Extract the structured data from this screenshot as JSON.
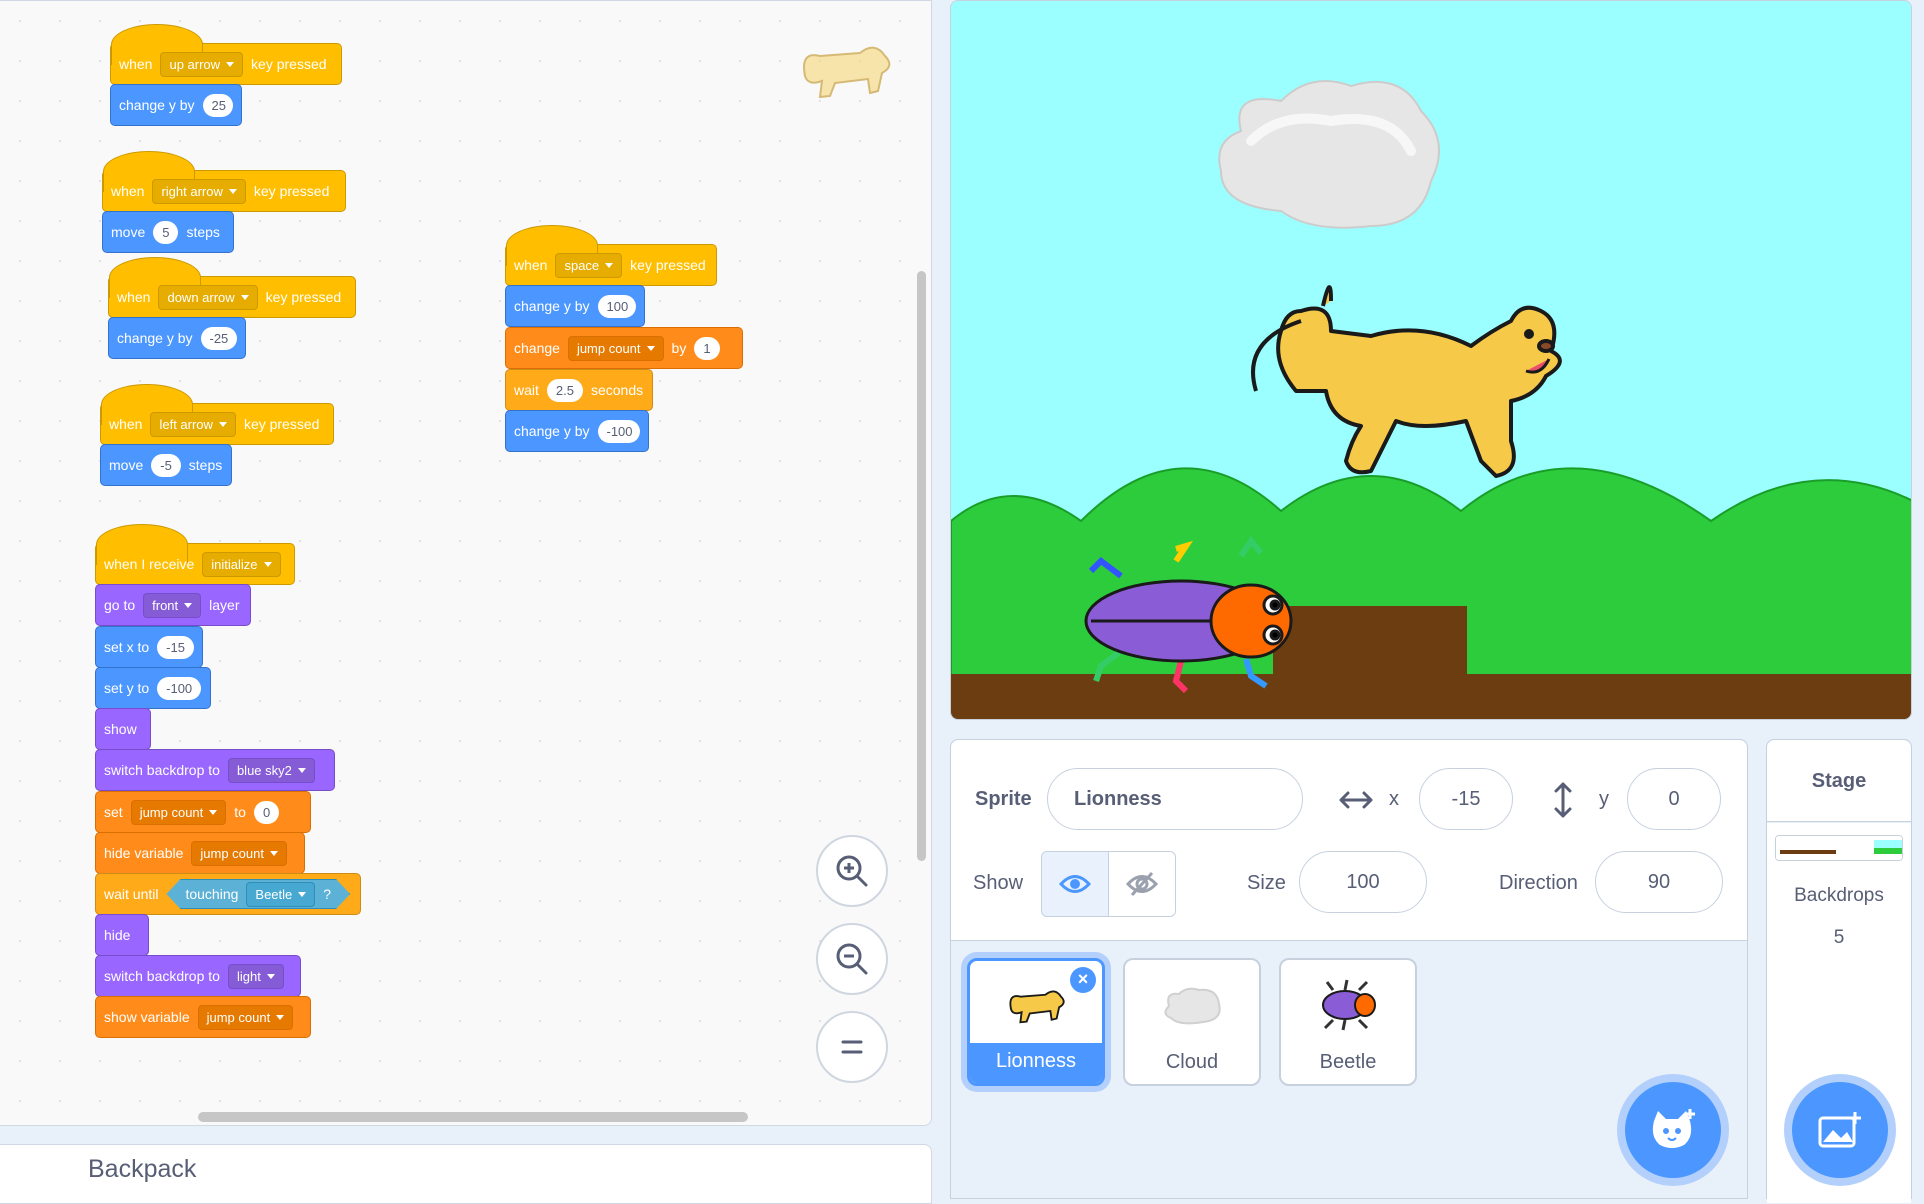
{
  "blocks": {
    "up": {
      "when": "when",
      "key": "up arrow",
      "pressed": "key pressed",
      "change": "change y by",
      "val": "25"
    },
    "right": {
      "when": "when",
      "key": "right arrow",
      "pressed": "key pressed",
      "move": "move",
      "val": "5",
      "steps": "steps"
    },
    "down": {
      "when": "when",
      "key": "down arrow",
      "pressed": "key pressed",
      "change": "change y by",
      "val": "-25"
    },
    "left": {
      "when": "when",
      "key": "left arrow",
      "pressed": "key pressed",
      "move": "move",
      "val": "-5",
      "steps": "steps"
    },
    "space": {
      "when": "when",
      "key": "space",
      "pressed": "key pressed",
      "change1": "change y by",
      "val1": "100",
      "change_var": "change",
      "var": "jump count",
      "by": "by",
      "by_val": "1",
      "wait": "wait",
      "wait_val": "2.5",
      "seconds": "seconds",
      "change2": "change y by",
      "val2": "-100"
    },
    "init": {
      "receive": "when I receive",
      "msg": "initialize",
      "goto": "go to",
      "layer_opt": "front",
      "layer": "layer",
      "setx": "set x to",
      "x": "-15",
      "sety": "set y to",
      "y": "-100",
      "show": "show",
      "switch1": "switch backdrop to",
      "backdrop1": "blue sky2",
      "set": "set",
      "set_var": "jump count",
      "to": "to",
      "set_val": "0",
      "hidevar": "hide variable",
      "hidevar_var": "jump count",
      "waituntil": "wait until",
      "touching": "touching",
      "touch_obj": "Beetle",
      "q": "?",
      "hide": "hide",
      "switch2": "switch backdrop to",
      "backdrop2": "light",
      "showvar": "show variable",
      "showvar_var": "jump count"
    }
  },
  "backpack": "Backpack",
  "sprite_info": {
    "sprite_label": "Sprite",
    "sprite_name": "Lionness",
    "x_label": "x",
    "x": "-15",
    "y_label": "y",
    "y": "0",
    "show_label": "Show",
    "size_label": "Size",
    "size": "100",
    "direction_label": "Direction",
    "direction": "90"
  },
  "sprites": [
    {
      "name": "Lionness",
      "selected": true
    },
    {
      "name": "Cloud",
      "selected": false
    },
    {
      "name": "Beetle",
      "selected": false
    }
  ],
  "stage_pane": {
    "title": "Stage",
    "backdrops_label": "Backdrops",
    "backdrops_count": "5"
  },
  "colors": {
    "accent": "#4c97ff",
    "events": "#ffbf00",
    "motion": "#4c97ff",
    "looks": "#9966ff",
    "variables": "#ff8c1a",
    "control": "#ffab19",
    "sensing": "#5cb1d6"
  }
}
